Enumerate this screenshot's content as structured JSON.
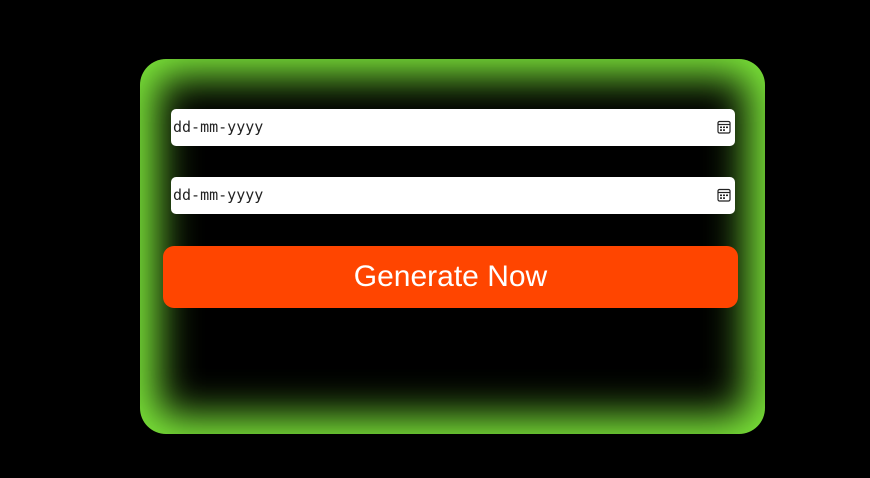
{
  "form": {
    "start_date": {
      "placeholder": "dd-mm-yyyy",
      "icon": "calendar-icon"
    },
    "end_date": {
      "placeholder": "dd-mm-yyyy",
      "icon": "calendar-icon"
    },
    "submit_label": "Generate Now"
  },
  "colors": {
    "background": "#000000",
    "glow": "#7de83a",
    "button": "#ff4500",
    "button_text": "#ffffff",
    "field": "#ffffff"
  }
}
